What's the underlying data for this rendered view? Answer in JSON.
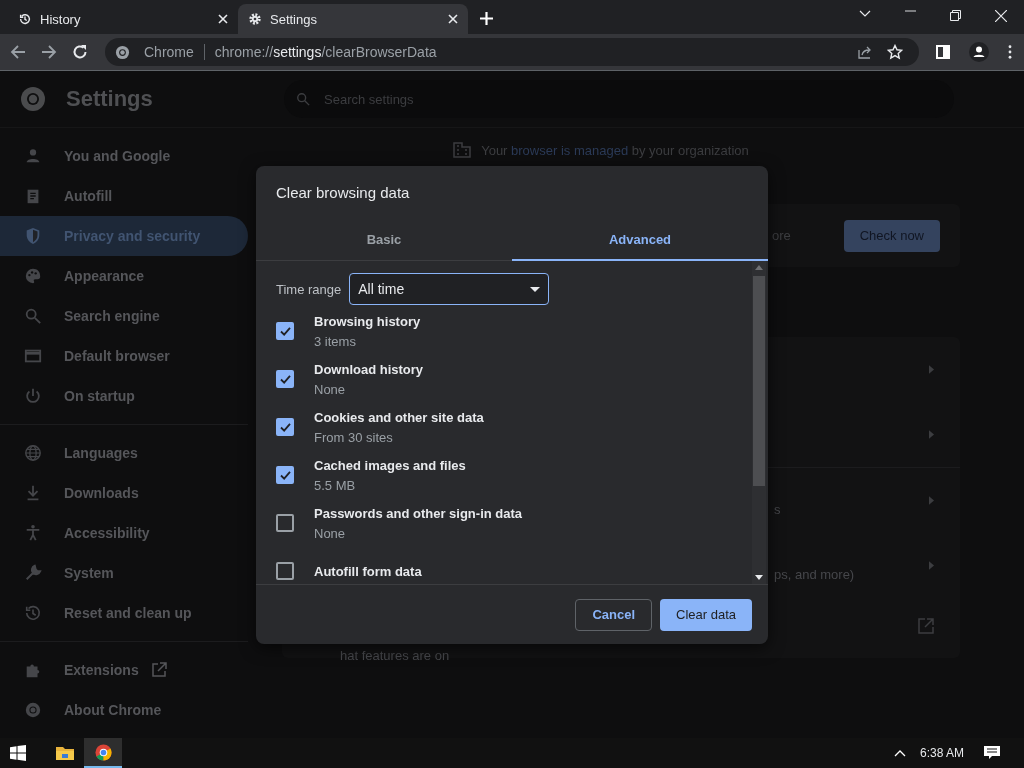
{
  "browser_tabs": [
    {
      "title": "History",
      "selected": false
    },
    {
      "title": "Settings",
      "selected": true
    }
  ],
  "address_bar": {
    "site": "Chrome",
    "url_prefix": "chrome://",
    "url_host": "settings",
    "url_path": "/clearBrowserData"
  },
  "header": {
    "title": "Settings",
    "search_placeholder": "Search settings"
  },
  "sidebar": {
    "sections": [
      [
        {
          "label": "You and Google",
          "selected": false
        },
        {
          "label": "Autofill",
          "selected": false
        },
        {
          "label": "Privacy and security",
          "selected": true
        },
        {
          "label": "Appearance",
          "selected": false
        },
        {
          "label": "Search engine",
          "selected": false
        },
        {
          "label": "Default browser",
          "selected": false
        },
        {
          "label": "On startup",
          "selected": false
        }
      ],
      [
        {
          "label": "Languages",
          "selected": false
        },
        {
          "label": "Downloads",
          "selected": false
        },
        {
          "label": "Accessibility",
          "selected": false
        },
        {
          "label": "System",
          "selected": false
        },
        {
          "label": "Reset and clean up",
          "selected": false
        }
      ],
      [
        {
          "label": "Extensions",
          "selected": false,
          "external": true
        },
        {
          "label": "About Chrome",
          "selected": false,
          "external": false
        }
      ]
    ]
  },
  "managed_notice": {
    "before": "Your ",
    "link": "browser is managed",
    "after": " by your organization"
  },
  "background": {
    "safety_fragment": "ore",
    "check_button": "Check now",
    "rows": [
      {
        "kind": "chevron"
      },
      {
        "kind": "chevron"
      },
      {
        "kind": "chevron",
        "text": "s"
      },
      {
        "kind": "chevron",
        "text": "ps, and more)"
      },
      {
        "kind": "external",
        "text": "hat features are on"
      }
    ]
  },
  "dialog": {
    "title": "Clear browsing data",
    "tabs": [
      {
        "label": "Basic",
        "selected": false
      },
      {
        "label": "Advanced",
        "selected": true
      }
    ],
    "time_range": {
      "label": "Time range",
      "value": "All time"
    },
    "items": [
      {
        "title": "Browsing history",
        "detail": "3 items",
        "checked": true
      },
      {
        "title": "Download history",
        "detail": "None",
        "checked": true
      },
      {
        "title": "Cookies and other site data",
        "detail": "From 30 sites",
        "checked": true
      },
      {
        "title": "Cached images and files",
        "detail": "5.5 MB",
        "checked": true
      },
      {
        "title": "Passwords and other sign-in data",
        "detail": "None",
        "checked": false
      },
      {
        "title": "Autofill form data",
        "checked": false
      }
    ],
    "buttons": [
      {
        "label": "Cancel",
        "kind": "secondary"
      },
      {
        "label": "Clear data",
        "kind": "primary"
      }
    ]
  },
  "taskbar": {
    "apps": [
      {
        "selected": false
      },
      {
        "selected": true
      }
    ],
    "time": "6:38 AM"
  }
}
